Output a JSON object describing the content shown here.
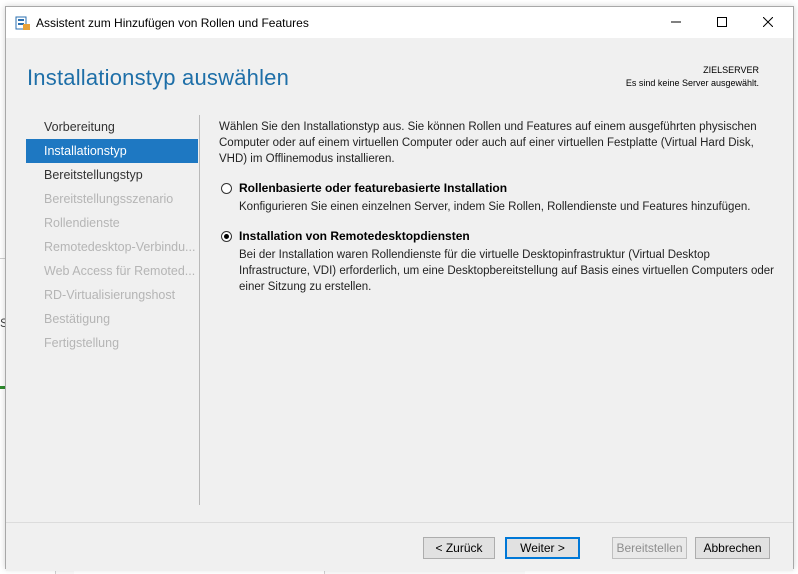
{
  "window": {
    "title": "Assistent zum Hinzufügen von Rollen und Features",
    "controls": {
      "minimize": "minimize-icon",
      "maximize": "maximize-icon",
      "close": "close-icon"
    }
  },
  "header": {
    "page_title": "Installationstyp auswählen",
    "server_label": "ZIELSERVER",
    "server_status": "Es sind keine Server ausgewählt."
  },
  "nav": {
    "items": [
      {
        "label": "Vorbereitung"
      },
      {
        "label": "Installationstyp"
      },
      {
        "label": "Bereitstellungstyp"
      },
      {
        "label": "Bereitstellungsszenario"
      },
      {
        "label": "Rollendienste"
      },
      {
        "label": "Remotedesktop-Verbindu..."
      },
      {
        "label": "Web Access für Remoted..."
      },
      {
        "label": "RD-Virtualisierungshost"
      },
      {
        "label": "Bestätigung"
      },
      {
        "label": "Fertigstellung"
      }
    ]
  },
  "main": {
    "intro": "Wählen Sie den Installationstyp aus. Sie können Rollen und Features auf einem ausgeführten physischen Computer oder auf einem virtuellen Computer oder auch auf einer virtuellen Festplatte (Virtual Hard Disk, VHD) im Offlinemodus installieren.",
    "options": [
      {
        "title": "Rollenbasierte oder featurebasierte Installation",
        "description": "Konfigurieren Sie einen einzelnen Server, indem Sie Rollen, Rollendienste und Features hinzufügen.",
        "selected": false
      },
      {
        "title": "Installation von Remotedesktopdiensten",
        "description": "Bei der Installation waren Rollendienste für die virtuelle Desktopinfrastruktur (Virtual Desktop Infrastructure, VDI) erforderlich, um eine Desktopbereitstellung auf Basis eines virtuellen Computers oder einer Sitzung zu erstellen.",
        "selected": true
      }
    ]
  },
  "footer": {
    "back": "< Zurück",
    "next": "Weiter >",
    "deploy": "Bereitstellen",
    "cancel": "Abbrechen"
  },
  "background": {
    "fragment": "S"
  },
  "colors": {
    "accent": "#1e78c2",
    "title": "#1e6fa8"
  }
}
